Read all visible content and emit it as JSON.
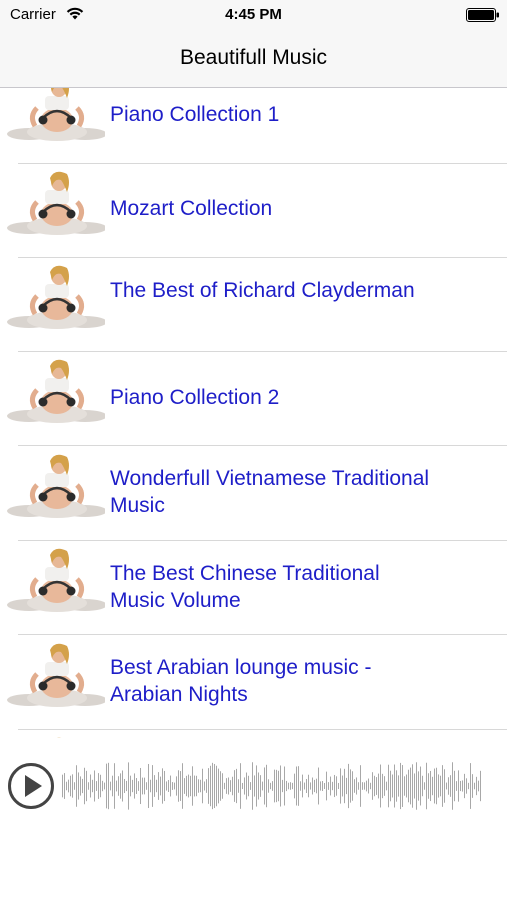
{
  "status_bar": {
    "carrier": "Carrier",
    "time": "4:45 PM"
  },
  "nav": {
    "title": "Beautifull Music"
  },
  "list": {
    "items": [
      {
        "label": "Piano Collection 1"
      },
      {
        "label": "Mozart Collection"
      },
      {
        "label": "The Best of Richard Clayderman"
      },
      {
        "label": "Piano Collection 2"
      },
      {
        "label": "Wonderfull Vietnamese Traditional Music"
      },
      {
        "label": "The Best Chinese Traditional Music Volume"
      },
      {
        "label": "Best Arabian lounge music - Arabian Nights"
      }
    ]
  },
  "colors": {
    "link": "#1e1ec8",
    "waveform": "#a8a8a8",
    "play_button": "#444444"
  }
}
